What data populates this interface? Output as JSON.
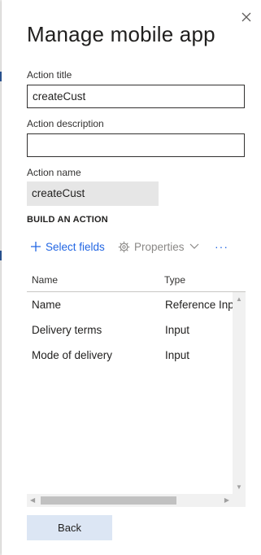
{
  "dialog": {
    "title": "Manage mobile app",
    "close_icon": "close-icon"
  },
  "form": {
    "action_title_label": "Action title",
    "action_title_value": "createCust",
    "action_description_label": "Action description",
    "action_description_value": "",
    "action_name_label": "Action name",
    "action_name_value": "createCust"
  },
  "build": {
    "heading": "BUILD AN ACTION",
    "select_fields_label": "Select fields",
    "select_fields_icon": "plus-icon",
    "properties_label": "Properties",
    "properties_icon": "gear-icon",
    "more_label": "···"
  },
  "grid": {
    "columns": [
      "Name",
      "Type"
    ],
    "rows": [
      {
        "name": "Name",
        "type": "Reference Inp"
      },
      {
        "name": "Delivery terms",
        "type": "Input"
      },
      {
        "name": "Mode of delivery",
        "type": "Input"
      }
    ]
  },
  "footer": {
    "back_label": "Back"
  },
  "colors": {
    "accent": "#2266e3",
    "button_bg": "#dce6f4",
    "readonly_bg": "#e6e6e6"
  }
}
